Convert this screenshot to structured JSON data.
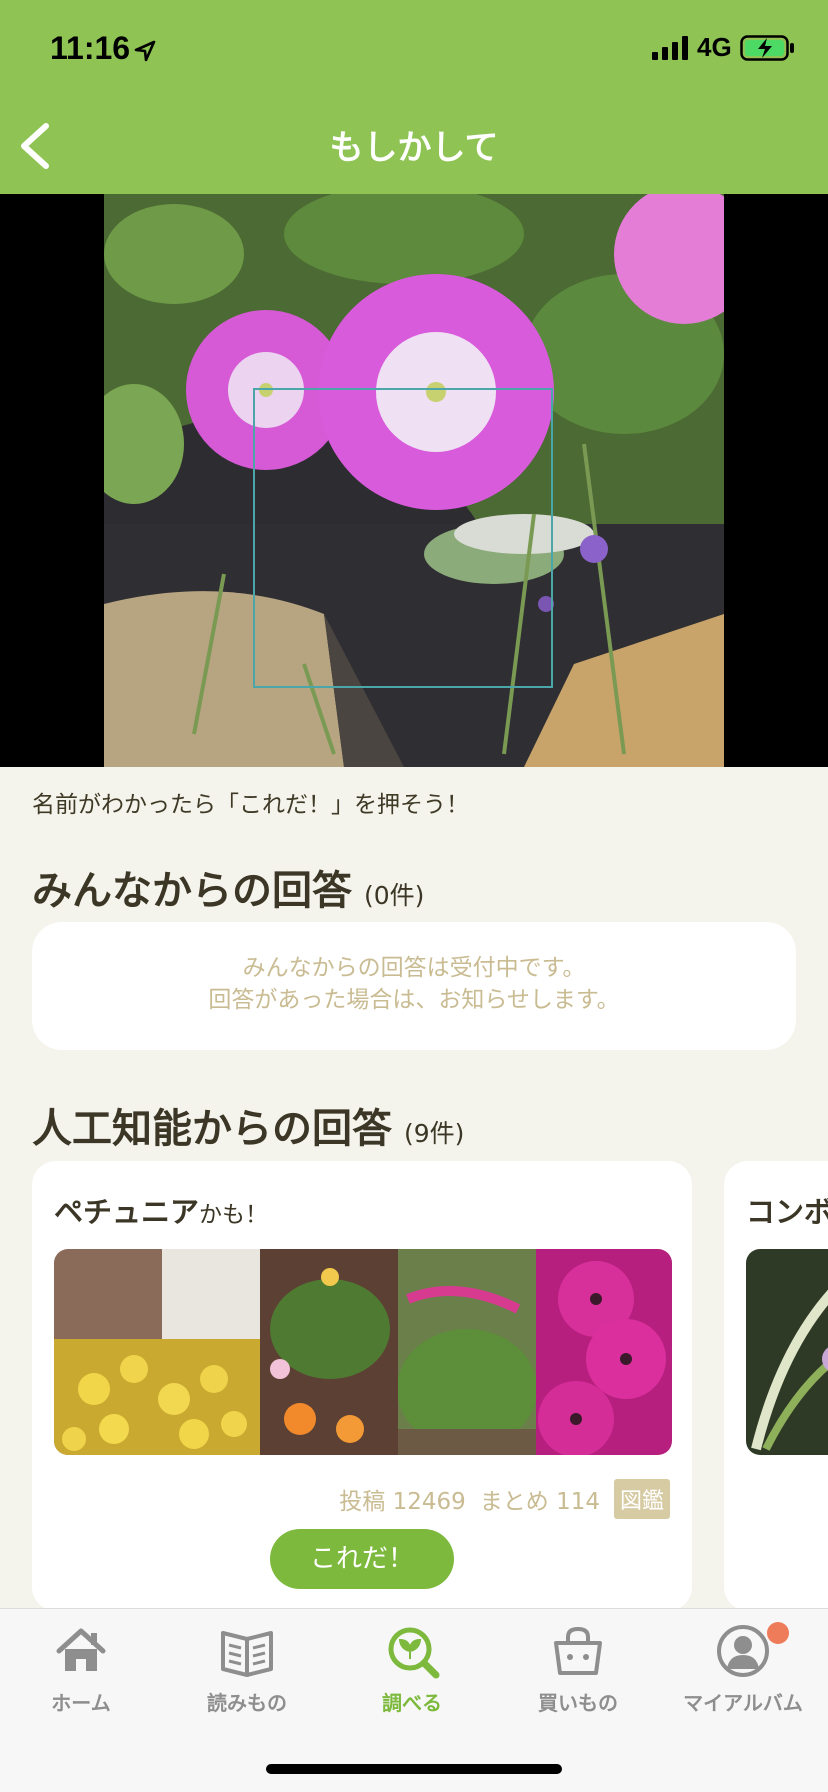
{
  "status": {
    "time": "11:16",
    "network": "4G"
  },
  "nav": {
    "title": "もしかして"
  },
  "hint": "名前がわかったら「これだ！」を押そう！",
  "community": {
    "title": "みんなからの回答",
    "count": "(0件)",
    "empty_line1": "みんなからの回答は受付中です。",
    "empty_line2": "回答があった場合は、お知らせします。"
  },
  "ai": {
    "title": "人工知能からの回答",
    "count": "(9件)",
    "cards": [
      {
        "name": "ペチュニア",
        "suffix": "かも！",
        "posts": "投稿 12469",
        "matome": "まとめ 114",
        "zukan": "図鑑",
        "button": "これだ！"
      },
      {
        "name": "コンボ"
      }
    ]
  },
  "tabs": [
    {
      "label": "ホーム",
      "icon": "home-icon"
    },
    {
      "label": "読みもの",
      "icon": "book-icon"
    },
    {
      "label": "調べる",
      "icon": "search-plant-icon",
      "active": true
    },
    {
      "label": "買いもの",
      "icon": "shopping-bag-icon"
    },
    {
      "label": "マイアルバム",
      "icon": "profile-icon"
    }
  ],
  "colors": {
    "header": "#8fc454",
    "accent": "#7db93c",
    "muted": "#c9bb92",
    "badge": "#ee7b5a"
  }
}
